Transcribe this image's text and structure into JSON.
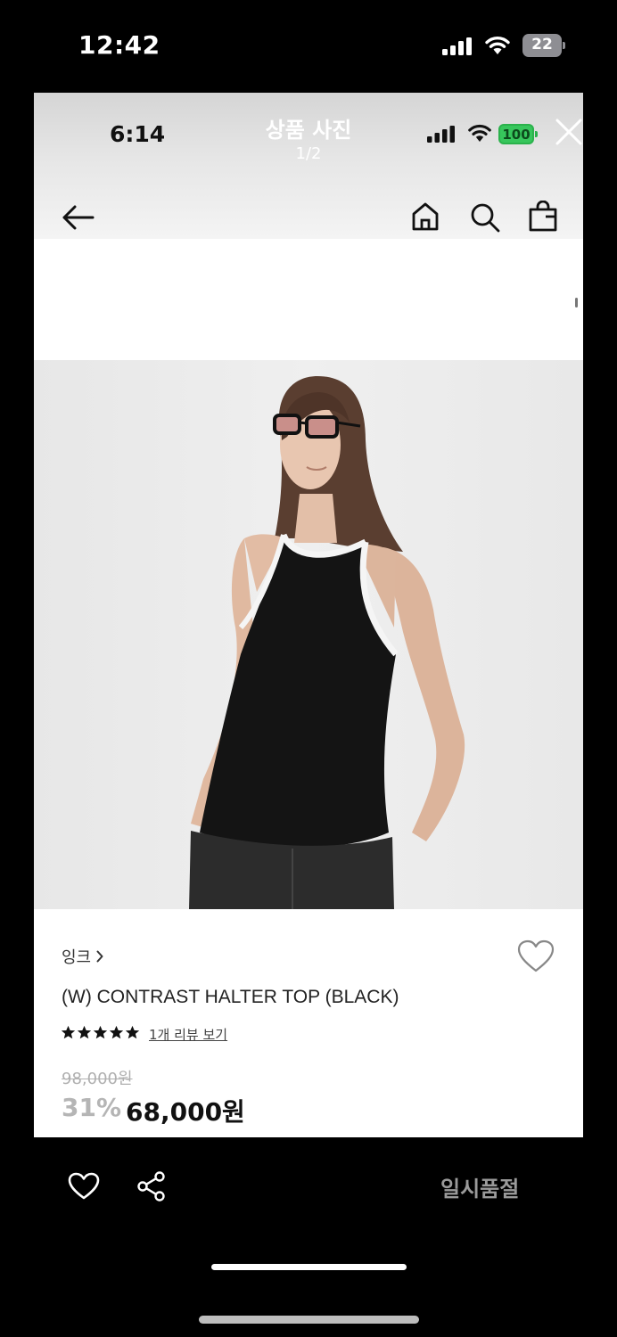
{
  "outer_status": {
    "time": "12:42",
    "battery": "22"
  },
  "inner_status": {
    "time": "6:14",
    "battery": "100"
  },
  "viewer": {
    "title": "상품 사진",
    "counter": "1/2"
  },
  "product": {
    "brand": "잉크",
    "name": "(W) CONTRAST HALTER TOP (BLACK)",
    "rating_stars": 5,
    "review_link": "1개 리뷰 보기",
    "original_price": "98,000원",
    "discount": "31%",
    "sale_price": "68,000원"
  },
  "bottom_bar": {
    "sold_out_label": "일시품절"
  },
  "icons": [
    "signal-icon",
    "wifi-icon",
    "battery-icon",
    "close-icon",
    "back-arrow-icon",
    "home-icon",
    "search-icon",
    "shopping-bag-icon",
    "heart-icon",
    "star-icon",
    "share-icon"
  ],
  "colors": {
    "battery_green": "#37c65c",
    "discount_gray": "#b5b5b5",
    "sold_out_gray": "#9a9a9a"
  }
}
